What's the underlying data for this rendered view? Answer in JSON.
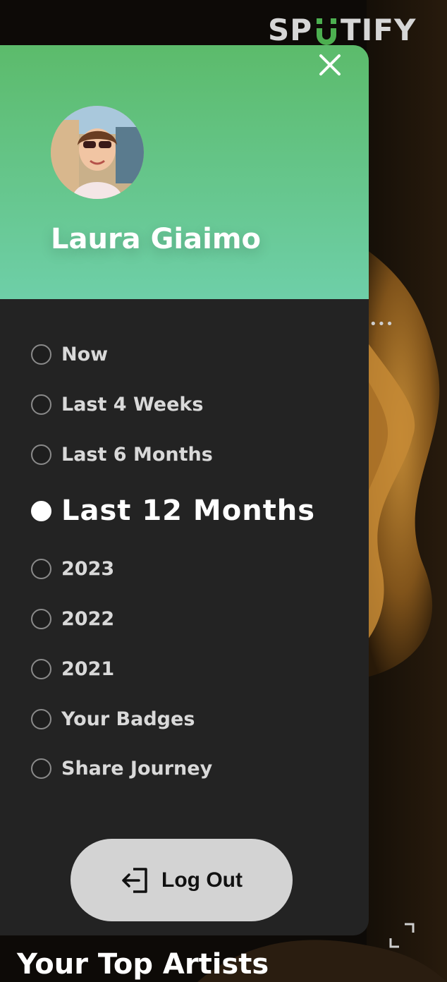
{
  "brand": {
    "logo_text": "SPOTIFY",
    "accent": "#4caf50"
  },
  "panel": {
    "header_gradient_top": "#5cbb6b",
    "header_gradient_bottom": "#6ecfa8",
    "close_icon": "close-icon",
    "user_name": "Laura Giaimo"
  },
  "menu": {
    "items": [
      {
        "label": "Now",
        "selected": false
      },
      {
        "label": "Last 4 Weeks",
        "selected": false
      },
      {
        "label": "Last 6 Months",
        "selected": false
      },
      {
        "label": "Last 12 Months",
        "selected": true
      },
      {
        "label": "2023",
        "selected": false
      },
      {
        "label": "2022",
        "selected": false
      },
      {
        "label": "2021",
        "selected": false
      },
      {
        "label": "Your Badges",
        "selected": false
      },
      {
        "label": "Share Journey",
        "selected": false
      }
    ]
  },
  "logout": {
    "label": "Log Out",
    "icon": "logout-icon"
  },
  "background": {
    "section_title": "Your Top Artists",
    "more_icon": "more-dots-icon",
    "expand_icon": "expand-icon"
  }
}
